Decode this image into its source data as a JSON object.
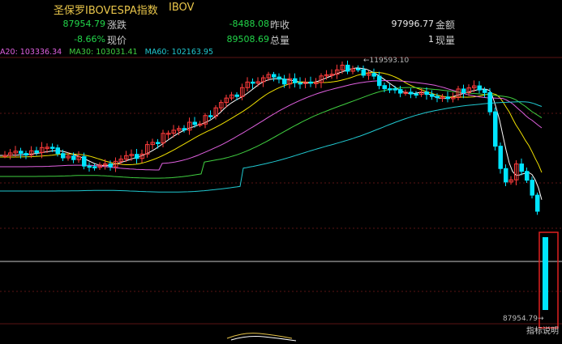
{
  "header": {
    "name": "圣保罗IBOVESPA指数",
    "code": "IBOV",
    "row1": {
      "last": "87954.79",
      "change_label": "涨跌",
      "change": "-8488.08",
      "prev_close_label": "昨收",
      "prev_close": "97996.77",
      "amount_label": "金额"
    },
    "row2": {
      "pct": "-8.66%",
      "price_label": "现价",
      "price": "89508.69",
      "volume_label": "总量",
      "cur_volume": "1",
      "cur_volume_label": "现量"
    }
  },
  "ma_legend": {
    "ma20": "A20: 103336.34",
    "ma30": "MA30: 103031.41",
    "ma60": "MA60: 102163.95"
  },
  "annotations": {
    "high": "119593.10",
    "low": "87954.79",
    "help": "指标说明"
  },
  "colors": {
    "up": "#ff3b3b",
    "down": "#00e5ff",
    "ma5": "#ffffff",
    "ma10": "#f0e000",
    "ma20": "#e060e0",
    "ma30": "#40d040",
    "ma60": "#20c8d0"
  }
}
